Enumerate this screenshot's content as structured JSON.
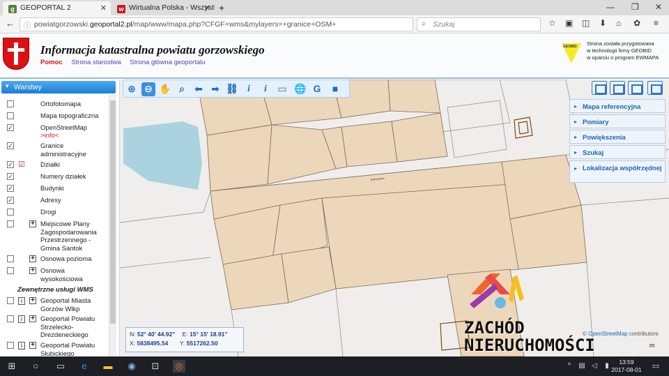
{
  "browser": {
    "tabs": [
      {
        "label": "GEOPORTAL 2",
        "icon": "g-icon",
        "color": "#5a7f3a"
      },
      {
        "label": "Wirtualna Polska - Wszystko",
        "icon": "wp-icon",
        "color": "#c91b1b"
      }
    ],
    "new_tab": "+",
    "url_prefix": "powiatgorzowski.",
    "url_domain": "geoportal2.pl",
    "url_suffix": "/map/www/mapa.php?CFGF=wms&mylayers=+granice+OSM+",
    "search_placeholder": "Szukaj"
  },
  "header": {
    "title": "Informacja katastralna powiatu gorzowskiego",
    "links": [
      "Pomoc",
      "Strona starostwa",
      "Strona główna geoportalu"
    ],
    "geobid_logo": "GEOBID",
    "info_lines": [
      "Strona została przygotowana",
      "w technologii firmy GEOBID",
      "w oparciu o program EWMAPA"
    ],
    "accent": "#c62828"
  },
  "sidebar": {
    "title": "Warstwy",
    "layers": [
      {
        "label": "Ortofotomapa",
        "checked": false
      },
      {
        "label": "Mapa topograficzna",
        "checked": false
      },
      {
        "label": "OpenStreetMap",
        "sub": ">info<",
        "checked": true
      },
      {
        "label": "Granice administracyjne",
        "checked": true
      },
      {
        "label": "Działki",
        "checked": true,
        "legend": true
      },
      {
        "label": "Numery działek",
        "checked": true
      },
      {
        "label": "Budynki",
        "checked": true
      },
      {
        "label": "Adresy",
        "checked": true
      },
      {
        "label": "Drogi",
        "checked": false
      },
      {
        "label": "Miejscowe Plany Zagospodarowania Przestrzennego - Gmina Santok",
        "checked": false,
        "expand": true
      },
      {
        "label": "Osnowa pozioma",
        "checked": false,
        "expand": true
      },
      {
        "label": "Osnowa wysokościowa",
        "checked": false,
        "expand": true
      }
    ],
    "wms_title": "Zewnętrzne usługi WMS",
    "wms": [
      {
        "label": "Geoportal Miasta Gorzów Wlkp",
        "checked": false
      },
      {
        "label": "Geoportal Powiatu Strzelecko-Drezdeneckiego",
        "checked": false
      },
      {
        "label": "Geoportal Powiatu Słubickiego",
        "checked": false
      }
    ]
  },
  "map": {
    "tools": [
      "zoom-in-icon",
      "zoom-out-icon",
      "pan-hand-icon",
      "zoom-box-icon",
      "back-arrow-icon",
      "forward-arrow-icon",
      "link-icon",
      "info-icon",
      "info-list-icon",
      "measure-icon",
      "globe-icon",
      "google-icon",
      "camera-icon"
    ],
    "right_panel": [
      "Mapa referencyjna",
      "Pomiary",
      "Powiększenia",
      "Szukaj",
      "Lokalizacja współrzędnej"
    ],
    "coords": {
      "n_label": "N:",
      "n_value": "52° 40' 44.92\"",
      "e_label": "E:",
      "e_value": "15° 15' 18.91\"",
      "x_label": "X:",
      "x_value": "5838495.54",
      "y_label": "Y:",
      "y_value": "5517262.50"
    },
    "credit_prefix": "© ",
    "credit_link": "OpenStreetMap",
    "credit_suffix": " contributors",
    "scale_unit": "m",
    "parcel_fill": "#ecd7bb",
    "water": "#aad3df"
  },
  "watermark": {
    "line1": "ZACHÓD",
    "line2": "NIERUCHOMOŚCI"
  },
  "taskbar": {
    "time": "13:59",
    "date": "2017-08-01"
  }
}
